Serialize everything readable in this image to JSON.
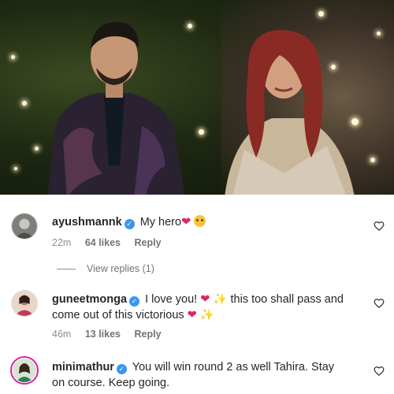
{
  "post": {
    "photo_alt": "photo"
  },
  "comments": [
    {
      "username": "ayushmannk",
      "verified": true,
      "text": "My hero",
      "emoji_after": [
        "heart",
        "pleading-face"
      ],
      "time": "22m",
      "likes": "64 likes",
      "reply_label": "Reply"
    },
    {
      "username": "guneetmonga",
      "verified": true,
      "text_1": "I love you!",
      "text_2": "this too shall pass and come out of this victorious",
      "time": "46m",
      "likes": "13 likes",
      "reply_label": "Reply"
    },
    {
      "username": "minimathur",
      "verified": true,
      "text": "You will win round 2 as well Tahira. Stay on course. Keep going."
    }
  ],
  "view_replies": "View replies (1)",
  "colors": {
    "verified": "#3897f0",
    "heart": "#e0245e",
    "meta": "#8e8e8e",
    "story_ring": "#d6249f"
  }
}
